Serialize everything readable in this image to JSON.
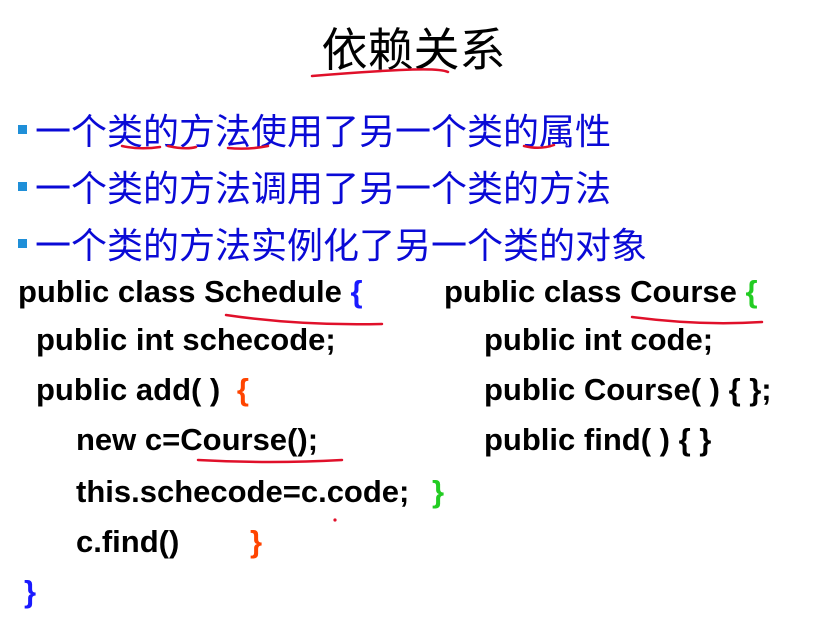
{
  "title": "依赖关系",
  "bullets": [
    "一个类的方法使用了另一个类的属性",
    "一个类的方法调用了另一个类的方法",
    "一个类的方法实例化了另一个类的对象"
  ],
  "code_left": {
    "l1": "public class Schedule",
    "l1_brace": "{",
    "l2": "public int schecode;",
    "l3": "public add( )",
    "l3_brace": "{",
    "l4": "new c=Course();",
    "l5": "this.schecode=c.code;",
    "l5_brace": "}",
    "l6": "c.find()",
    "l6_brace": "}",
    "l7_brace": "}"
  },
  "code_right": {
    "l1": "public class Course",
    "l1_brace": "{",
    "l2": "public int code;",
    "l3": "public Course( ) { };",
    "l4": "public find( ) { }"
  },
  "colors": {
    "bullet_text": "#0a0ad6",
    "annotation": "#e0102a",
    "brace_blue": "#1a1aff",
    "brace_green": "#22cc22",
    "brace_orange": "#ff4400"
  }
}
